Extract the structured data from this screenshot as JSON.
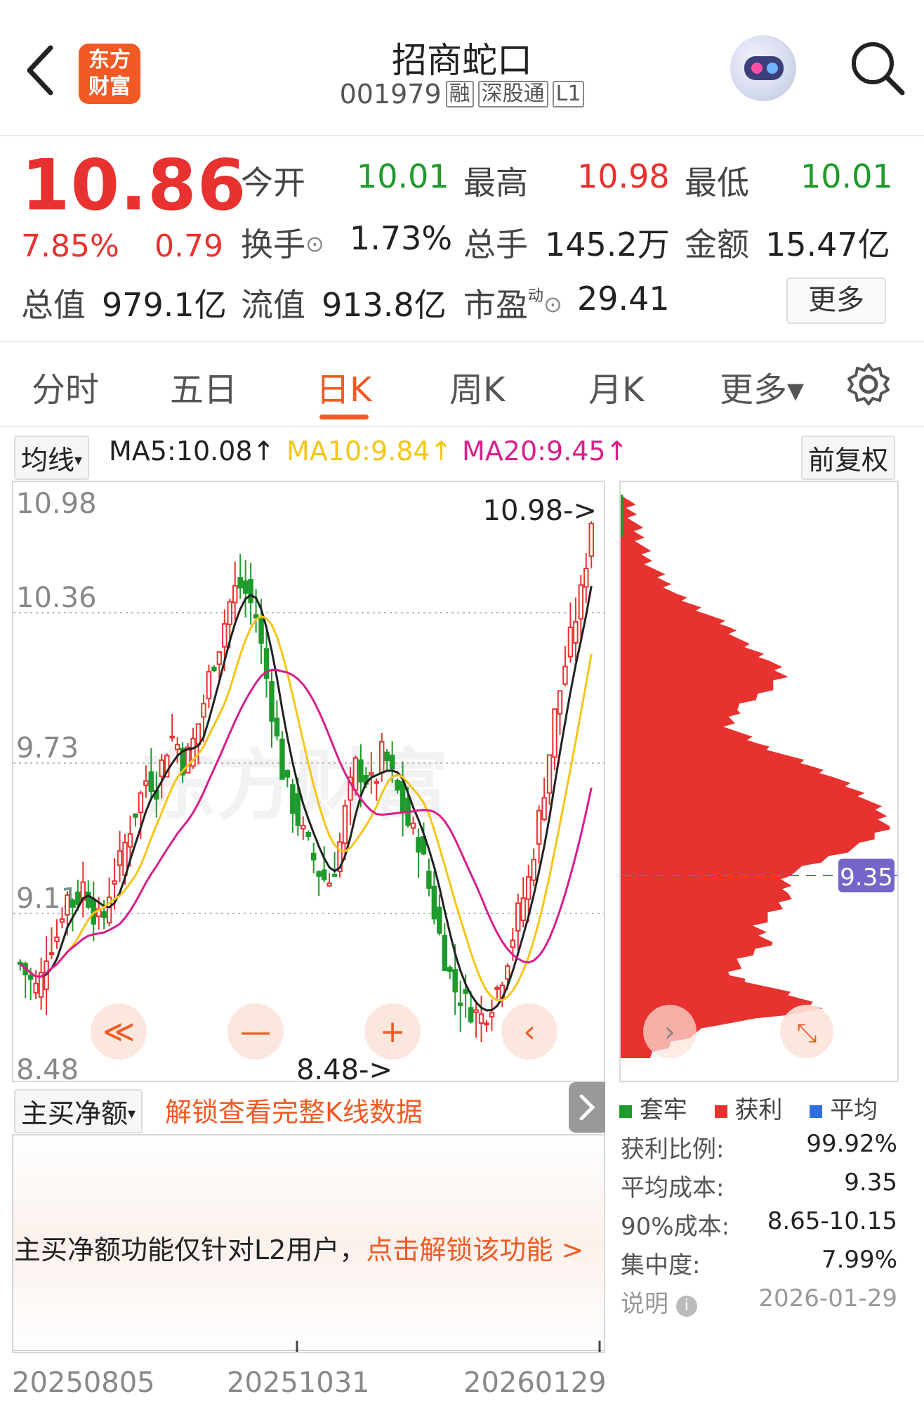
{
  "header": {
    "back_icon": "chevron-left-icon",
    "logo_line1": "东方",
    "logo_line2": "财富",
    "title": "招商蛇口",
    "code": "001979",
    "tags": [
      "融",
      "深股通",
      "L1"
    ],
    "robot_icon": "robot-assistant-icon",
    "search_icon": "search-icon"
  },
  "quote": {
    "price": "10.86",
    "change_pct": "7.85%",
    "change": "0.79",
    "open_label": "今开",
    "open": "10.01",
    "high_label": "最高",
    "high": "10.98",
    "low_label": "最低",
    "low": "10.01",
    "turnover_label": "换手",
    "turnover": "1.73%",
    "volume_label": "总手",
    "volume": "145.2万",
    "amount_label": "金额",
    "amount": "15.47亿",
    "mktcap_label": "总值",
    "mktcap": "979.1亿",
    "float_label": "流值",
    "float": "913.8亿",
    "pe_label": "市盈",
    "pe_sup": "动",
    "pe": "29.41",
    "more_button": "更多"
  },
  "tabs": [
    "分时",
    "五日",
    "日K",
    "周K",
    "月K",
    "更多▾"
  ],
  "active_tab": "日K",
  "ma": {
    "selector": "均线",
    "ma5": "MA5:10.08↑",
    "ma10": "MA10:9.84↑",
    "ma20": "MA20:9.45↑",
    "adjust_button": "前复权",
    "colors": {
      "ma5": "#222222",
      "ma10": "#f5c518",
      "ma20": "#d81e8c"
    }
  },
  "kline": {
    "y_ticks": [
      "10.98",
      "10.36",
      "9.73",
      "9.11",
      "8.48"
    ],
    "max_marker": "10.98->",
    "min_marker": "8.48->",
    "watermark": "东方财富",
    "nav_buttons": [
      "≪",
      "—",
      "+",
      "‹"
    ],
    "up_color": "#e8322f",
    "down_color": "#1f9a2c"
  },
  "chip": {
    "avg_cost_marker": "9.35",
    "legend": [
      "套牢",
      "获利",
      "平均"
    ],
    "legend_colors": [
      "#1f9a2c",
      "#e8322f",
      "#2f6fe0"
    ],
    "rows": [
      {
        "label": "获利比例:",
        "value": "99.92%"
      },
      {
        "label": "平均成本:",
        "value": "9.35"
      },
      {
        "label": "90%成本:",
        "value": "8.65-10.15"
      },
      {
        "label": "集中度:",
        "value": "7.99%"
      }
    ],
    "note_label": "说明",
    "date": "2026-01-29"
  },
  "indicator": {
    "selector": "主买净额",
    "unlock_text": "解锁查看完整K线数据",
    "message": "主买净额功能仅针对L2用户，",
    "message_link": "点击解锁该功能 >",
    "x_ticks": [
      "20250805",
      "20251031",
      "20260129"
    ]
  }
}
